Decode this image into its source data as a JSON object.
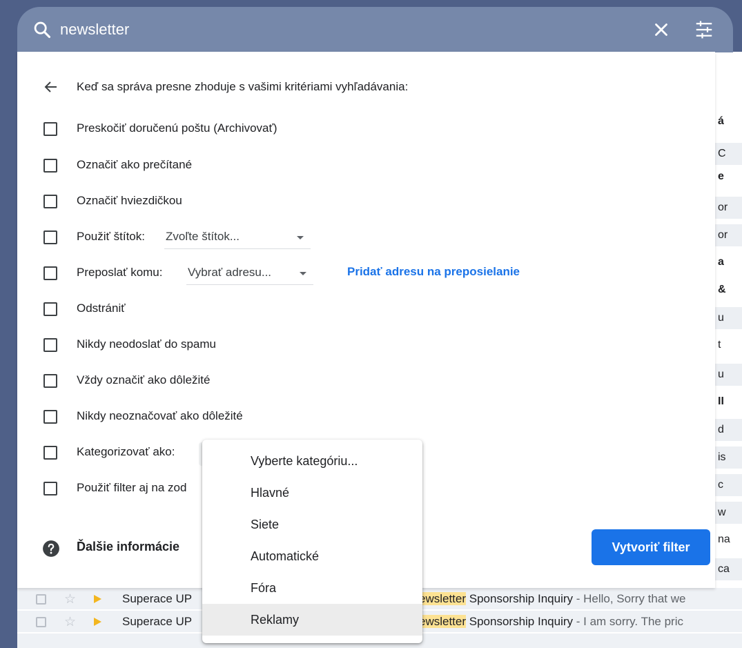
{
  "search": {
    "query": "newsletter"
  },
  "filter": {
    "header": "Keď sa správa presne zhoduje s vašimi kritériami vyhľadávania:",
    "options": [
      {
        "label": "Preskočiť doručenú poštu (Archivovať)",
        "checked": false
      },
      {
        "label": "Označiť ako prečítané",
        "checked": false
      },
      {
        "label": "Označiť hviezdičkou",
        "checked": false
      },
      {
        "label": "Použiť štítok:",
        "checked": false,
        "dropdown": "Zvoľte štítok..."
      },
      {
        "label": "Preposlať komu:",
        "checked": false,
        "dropdown": "Vybrať adresu...",
        "link": "Pridať adresu na preposielanie"
      },
      {
        "label": "Odstrániť",
        "checked": false
      },
      {
        "label": "Nikdy neodoslať do spamu",
        "checked": false
      },
      {
        "label": "Vždy označiť ako dôležité",
        "checked": false
      },
      {
        "label": "Nikdy neoznačovať ako dôležité",
        "checked": false
      },
      {
        "label": "Kategorizovať ako:",
        "checked": false
      },
      {
        "label": "Použiť filter aj na zod",
        "checked": false
      }
    ],
    "help_text": "Ďalšie informácie",
    "create_button": "Vytvoriť filter"
  },
  "category_menu": {
    "items": [
      "Vyberte kategóriu...",
      "Hlavné",
      "Siete",
      "Automatické",
      "Fóra",
      "Reklamy"
    ],
    "highlighted": "Reklamy"
  },
  "background_inbox": {
    "right_fragments": [
      "á",
      "C",
      "e",
      "or",
      "or",
      "a",
      "&",
      "u",
      "t",
      "u",
      "II",
      "d",
      "is",
      "c",
      "w",
      "na",
      "ca"
    ],
    "rows": [
      {
        "sender": "Superace UP",
        "subject_highlight": "ewsletter",
        "subject": " Sponsorship Inquiry",
        "snippet": " - Hello, Sorry that we"
      },
      {
        "sender": "Superace UP",
        "subject_highlight": "ewsletter",
        "subject": " Sponsorship Inquiry",
        "snippet": " - I am sorry. The pric"
      }
    ]
  },
  "colors": {
    "accent": "#1a73e8",
    "search_bar": "#7688aa",
    "highlight": "#fde293",
    "important_marker": "#f3b61f"
  }
}
